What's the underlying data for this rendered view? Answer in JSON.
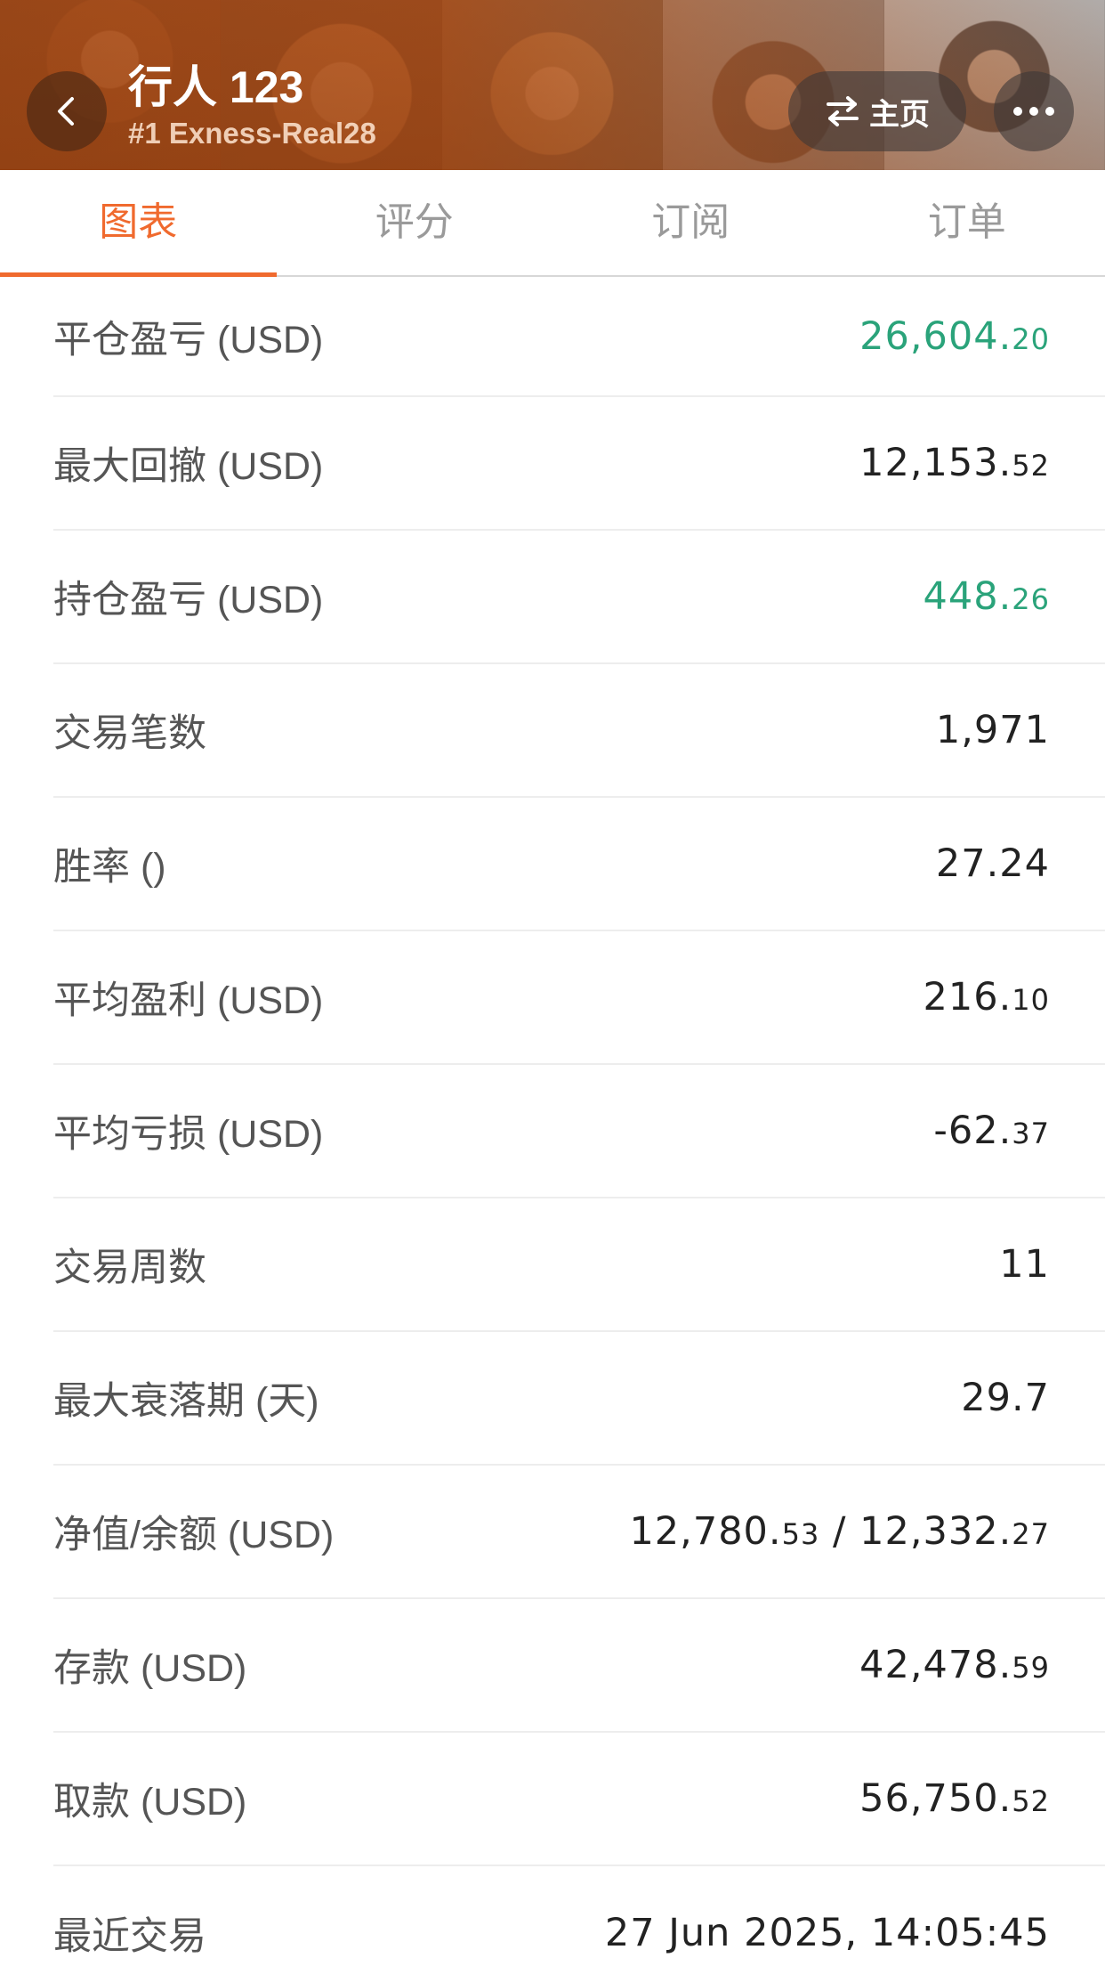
{
  "header": {
    "title": "行人 123",
    "subtitle": "#1 Exness-Real28",
    "home_label": "主页",
    "icons": {
      "back": "chevron-left-icon",
      "home": "swap-arrows-icon",
      "more": "more-dots-icon"
    }
  },
  "tabs": [
    {
      "label": "图表",
      "active": true
    },
    {
      "label": "评分",
      "active": false
    },
    {
      "label": "订阅",
      "active": false
    },
    {
      "label": "订单",
      "active": false
    }
  ],
  "colors": {
    "accent": "#f06a2e",
    "positive": "#2aa37a",
    "label": "#555555",
    "value": "#222222"
  },
  "stats": [
    {
      "label": "平仓盈亏 (USD)",
      "int": "26,604.",
      "dec": "20",
      "color": "green"
    },
    {
      "label": "最大回撤 (USD)",
      "int": "12,153.",
      "dec": "52",
      "color": ""
    },
    {
      "label": "持仓盈亏 (USD)",
      "int": "448.",
      "dec": "26",
      "color": "green"
    },
    {
      "label": "交易笔数",
      "int": "1,971",
      "dec": "",
      "color": ""
    },
    {
      "label": "胜率 ()",
      "int": "27.24",
      "dec": "",
      "color": ""
    },
    {
      "label": "平均盈利 (USD)",
      "int": "216.",
      "dec": "10",
      "color": ""
    },
    {
      "label": "平均亏损 (USD)",
      "int": "-62.",
      "dec": "37",
      "color": ""
    },
    {
      "label": "交易周数",
      "int": "11",
      "dec": "",
      "color": ""
    },
    {
      "label": "最大衰落期 (天)",
      "int": "29.7",
      "dec": "",
      "color": ""
    },
    {
      "label": "净值/余额 (USD)",
      "int": "12,780.",
      "dec": "53",
      "sep": " / ",
      "int2": "12,332.",
      "dec2": "27",
      "color": ""
    },
    {
      "label": "存款 (USD)",
      "int": "42,478.",
      "dec": "59",
      "color": ""
    },
    {
      "label": "取款 (USD)",
      "int": "56,750.",
      "dec": "52",
      "color": ""
    },
    {
      "label": "最近交易",
      "int": "27 Jun 2025, 14:05:45",
      "dec": "",
      "color": ""
    }
  ]
}
